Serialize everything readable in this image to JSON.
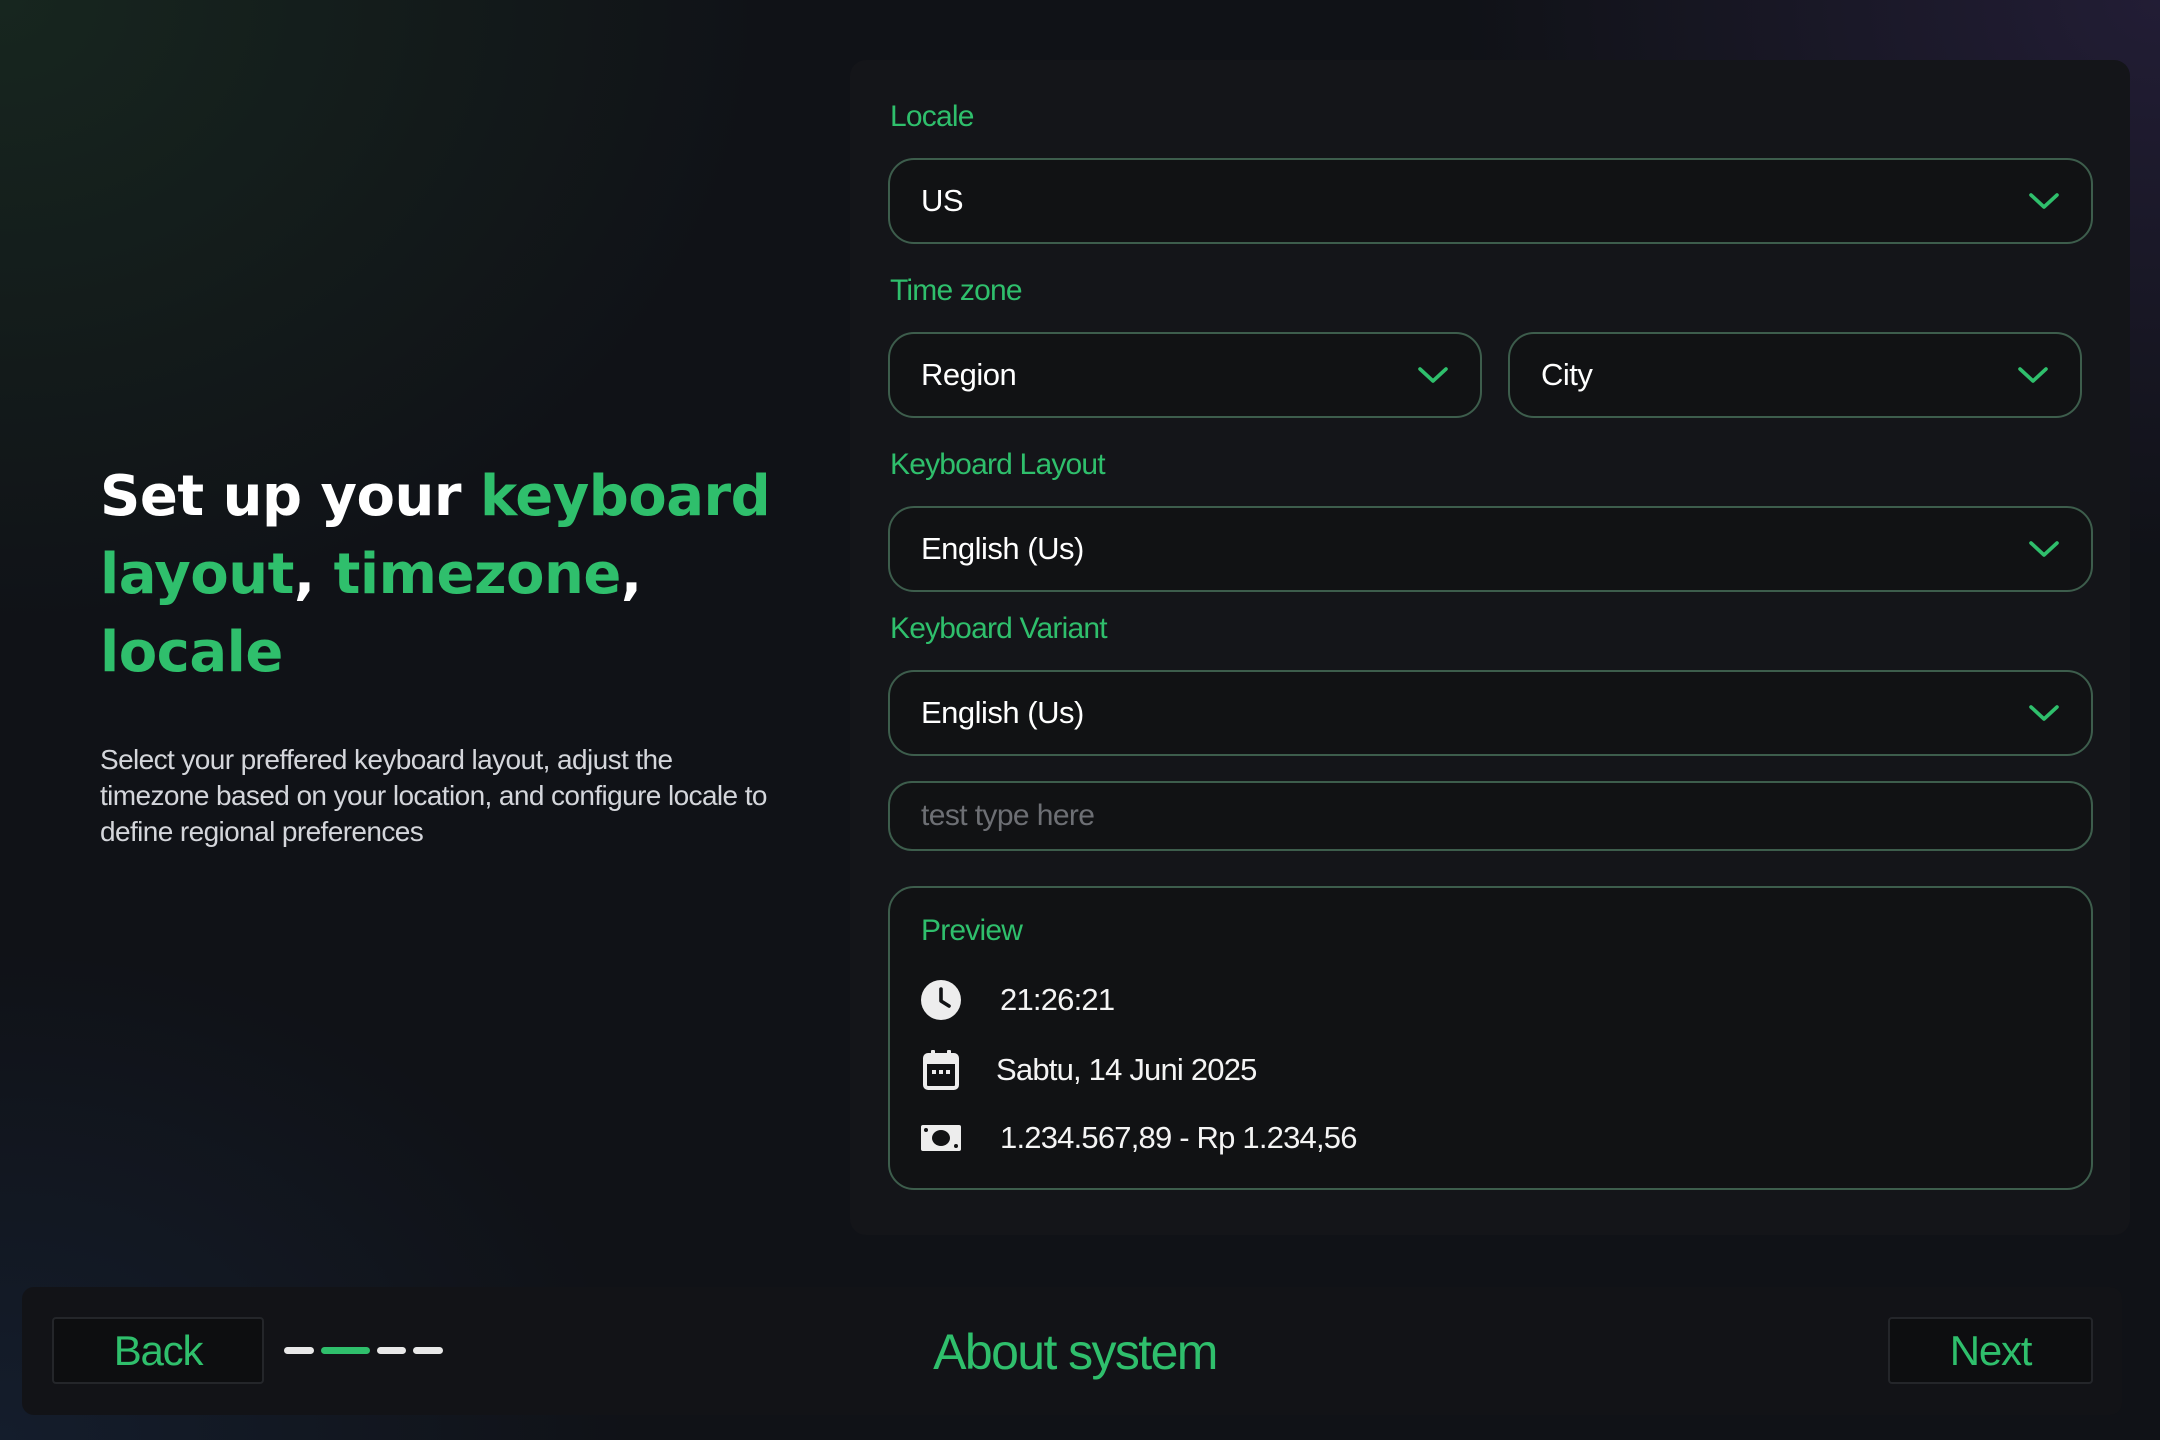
{
  "hero": {
    "title_part1": "Set up your ",
    "title_highlight1": "keyboard layout",
    "title_sep1": ", ",
    "title_highlight2": "timezone",
    "title_sep2": ", ",
    "title_highlight3": "locale",
    "description": "Select your preffered keyboard layout, adjust the timezone based on your location, and configure locale to define regional preferences"
  },
  "form": {
    "locale": {
      "label": "Locale",
      "value": "US"
    },
    "timezone": {
      "label": "Time zone",
      "region": "Region",
      "city": "City"
    },
    "keyboard_layout": {
      "label": "Keyboard Layout",
      "value": "English (Us)"
    },
    "keyboard_variant": {
      "label": "Keyboard Variant",
      "value": "English (Us)"
    },
    "test_input": {
      "placeholder": "test type here",
      "value": ""
    }
  },
  "preview": {
    "title": "Preview",
    "time": "21:26:21",
    "date": "Sabtu, 14 Juni 2025",
    "currency": "1.234.567,89 - Rp 1.234,56",
    "icons": [
      "clock-icon",
      "calendar-icon",
      "money-icon"
    ]
  },
  "footer": {
    "back_label": "Back",
    "next_label": "Next",
    "title": "About system",
    "steps_total": 4,
    "steps_active": 2
  },
  "colors": {
    "accent": "#2fbf6c",
    "border": "#3d5d4c",
    "panel": "#141519",
    "field": "#111214"
  }
}
